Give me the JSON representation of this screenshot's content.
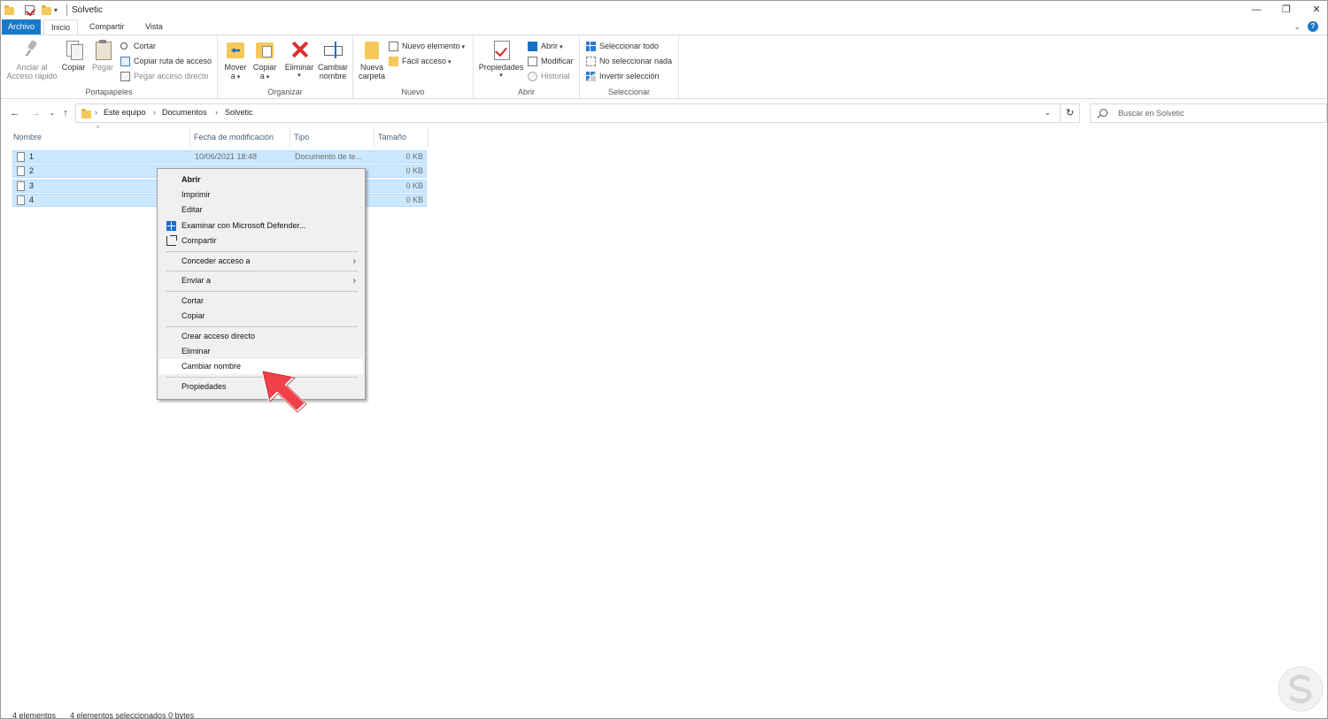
{
  "window": {
    "title": "Solvetic",
    "controls": {
      "minimize": "—",
      "restore": "❐",
      "close": "✕"
    }
  },
  "ribbon_tabs": [
    "Archivo",
    "Inicio",
    "Compartir",
    "Vista"
  ],
  "ribbon": {
    "portapapeles": {
      "label": "Portapapeles",
      "pin": "Anclar al\nAcceso rápido",
      "copy": "Copiar",
      "paste": "Pegar",
      "cut": "Cortar",
      "copy_path": "Copiar ruta de acceso",
      "paste_shortcut": "Pegar acceso directo"
    },
    "organizar": {
      "label": "Organizar",
      "move": "Mover\na",
      "copy_to": "Copiar\na",
      "delete": "Eliminar",
      "rename": "Cambiar\nnombre"
    },
    "nuevo": {
      "label": "Nuevo",
      "new_folder": "Nueva\ncarpeta",
      "new_item": "Nuevo elemento",
      "easy_access": "Fácil acceso"
    },
    "abrir": {
      "label": "Abrir",
      "properties": "Propiedades",
      "open": "Abrir",
      "edit": "Modificar",
      "history": "Historial"
    },
    "seleccionar": {
      "label": "Seleccionar",
      "select_all": "Seleccionar todo",
      "select_none": "No seleccionar nada",
      "invert": "Invertir selección"
    }
  },
  "address": {
    "crumbs": [
      "Este equipo",
      "Documentos",
      "Solvetic"
    ],
    "search_placeholder": "Buscar en Solvetic"
  },
  "columns": [
    "Nombre",
    "Fecha de modificación",
    "Tipo",
    "Tamaño"
  ],
  "files": [
    {
      "name": "1",
      "date": "10/06/2021 18:48",
      "type": "Documento de te...",
      "size": "0 KB"
    },
    {
      "name": "2",
      "date": "",
      "type": "",
      "size": "0 KB"
    },
    {
      "name": "3",
      "date": "",
      "type": "",
      "size": "0 KB"
    },
    {
      "name": "4",
      "date": "",
      "type": "",
      "size": "0 KB"
    }
  ],
  "context_menu": {
    "open": "Abrir",
    "print": "Imprimir",
    "edit": "Editar",
    "defender": "Examinar con Microsoft Defender...",
    "share": "Compartir",
    "grant_access": "Conceder acceso a",
    "send_to": "Enviar a",
    "cut": "Cortar",
    "copy": "Copiar",
    "create_shortcut": "Crear acceso directo",
    "delete": "Eliminar",
    "rename": "Cambiar nombre",
    "properties": "Propiedades",
    "highlighted_item": "Cambiar nombre"
  },
  "status": {
    "count": "4 elementos",
    "selected": "4 elementos seleccionados 0 bytes"
  },
  "colors": {
    "accent": "#1979ca",
    "selection": "#cce8ff",
    "pointer": "#f0404a"
  }
}
